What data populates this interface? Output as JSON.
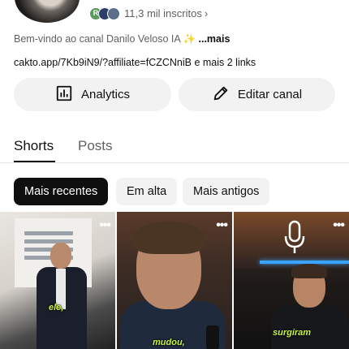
{
  "channel": {
    "subscriber_avatars": [
      "R",
      "",
      ""
    ],
    "subscribers_label": "11,3 mil inscritos",
    "description": "Bem-vindo ao canal Danilo Veloso IA ✨",
    "description_more": "...mais",
    "link_text": "cakto.app/7Kb9iN9/?affiliate=fCZCNniB e mais 2 links"
  },
  "actions": {
    "analytics_label": "Analytics",
    "analytics_icon": "bar-chart-icon",
    "edit_label": "Editar canal",
    "edit_icon": "pencil-icon"
  },
  "tabs": [
    {
      "label": "Shorts",
      "selected": true
    },
    {
      "label": "Posts",
      "selected": false
    }
  ],
  "filters": [
    {
      "label": "Mais recentes",
      "selected": true
    },
    {
      "label": "Em alta",
      "selected": false
    },
    {
      "label": "Mais antigos",
      "selected": false
    }
  ],
  "shorts": [
    {
      "caption": "ele,",
      "menu_icon": "more-vert-icon"
    },
    {
      "caption": "mudou,",
      "menu_icon": "more-vert-icon"
    },
    {
      "caption": "surgiram",
      "menu_icon": "more-vert-icon"
    }
  ],
  "colors": {
    "accent_text": "#0f0f0f",
    "secondary_text": "#606060",
    "chip_bg": "#f2f2f2",
    "caption_color": "#c8f542"
  }
}
